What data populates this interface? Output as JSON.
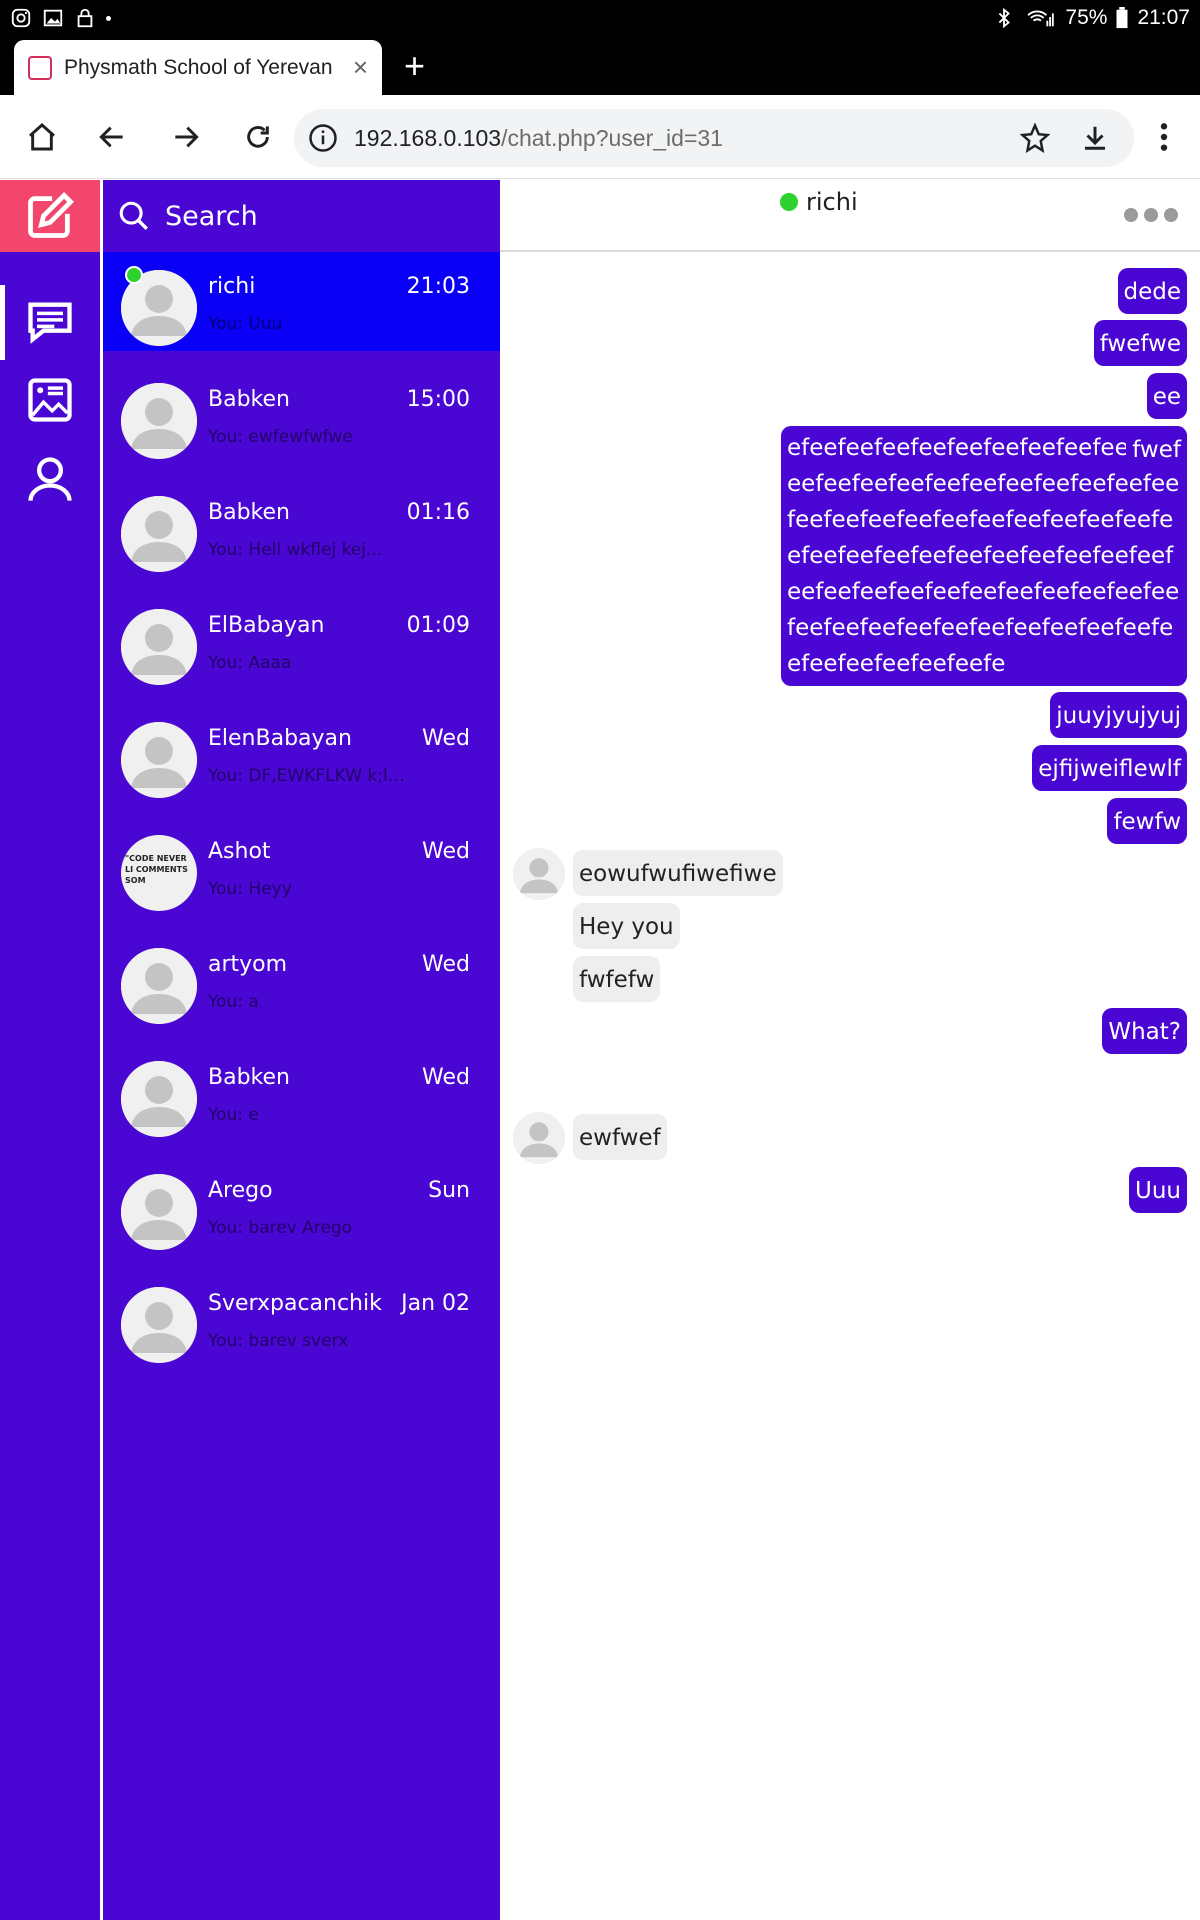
{
  "status_bar": {
    "battery": "75%",
    "time": "21:07"
  },
  "browser": {
    "tab_title": "Physmath School of Yerevan",
    "url_host": "192.168.0.103",
    "url_path": "/chat.php?user_id=31"
  },
  "sidebar": {
    "search_label": "Search"
  },
  "conversations": [
    {
      "name": "richi",
      "time": "21:03",
      "preview": "You: Uuu",
      "online": true,
      "active": true
    },
    {
      "name": "Babken",
      "time": "15:00",
      "preview": "You: ewfewfwfwe"
    },
    {
      "name": "Babken",
      "time": "01:16",
      "preview": "You: Hell wkflej kej..."
    },
    {
      "name": "ElBabayan",
      "time": "01:09",
      "preview": "You: Aaaa"
    },
    {
      "name": "ElenBabayan",
      "time": "Wed",
      "preview": "You: DF,EWKFLKW k;lk..."
    },
    {
      "name": "Ashot",
      "time": "Wed",
      "preview": "You: Heyy",
      "avatar_text": "\"CODE NEVER LI COMMENTS SOM"
    },
    {
      "name": "artyom",
      "time": "Wed",
      "preview": "You: a"
    },
    {
      "name": "Babken",
      "time": "Wed",
      "preview": "You: e"
    },
    {
      "name": "Arego",
      "time": "Sun",
      "preview": "You: barev Arego"
    },
    {
      "name": "Sverxpacanchik",
      "time": "Jan 02",
      "preview": "You: barev sverx"
    }
  ],
  "chat": {
    "contact_name": "richi",
    "messages": [
      {
        "dir": "out",
        "text": "dede"
      },
      {
        "dir": "out",
        "text": "fwefwe"
      },
      {
        "dir": "out",
        "text": "ee"
      },
      {
        "dir": "out",
        "text": "efeefeefeefeefeefeefeefeefeefeefeefeefeefeefeefeefeefeefeefeefeefeefeefeefeefeefeefeefeefeefeefeefeefeefeefeefeefeefeefeefeefeefeefeefeefeefeefeefeefeefeefeefeefeefeefeefeefeefeefeefeefeefeefeefeefeefeefeefeefe"
      },
      {
        "dir": "out",
        "text": "fwef"
      },
      {
        "dir": "out",
        "text": "juuyjyujyuj"
      },
      {
        "dir": "out",
        "text": "ejfijweiflewlf"
      },
      {
        "dir": "out",
        "text": "fewfw"
      },
      {
        "dir": "in",
        "text": "eowufwufiwefiwe"
      },
      {
        "dir": "in",
        "text": "Hey you"
      },
      {
        "dir": "in",
        "text": "fwfefw"
      },
      {
        "dir": "out",
        "text": "What?"
      },
      {
        "dir": "in",
        "text": "ewfwef"
      },
      {
        "dir": "out",
        "text": "Uuu"
      }
    ]
  }
}
